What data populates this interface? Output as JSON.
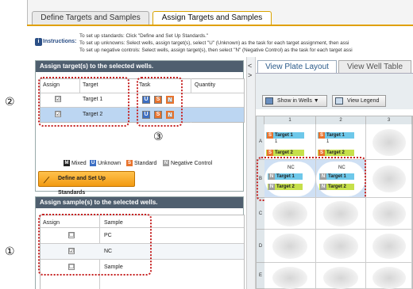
{
  "tabs": {
    "define": "Define Targets and Samples",
    "assign": "Assign Targets and Samples"
  },
  "instructions": {
    "label": "Instructions:",
    "line1": "To set up standards: Click \"Define and Set Up Standards.\"",
    "line2": "To set up unknowns: Select wells, assign target(s), select \"U\" (Unknown) as the task for each target assignment, then assi",
    "line3": "To set up negative controls: Select wells, assign target(s), then select \"N\" (Negative Control) as the task for each target assi"
  },
  "assign_targets": {
    "title": "Assign target(s) to the selected wells.",
    "headers": {
      "assign": "Assign",
      "target": "Target",
      "task": "Task",
      "quantity": "Quantity"
    },
    "rows": [
      {
        "checked": "☑",
        "target": "Target 1"
      },
      {
        "checked": "☑",
        "target": "Target 2"
      }
    ],
    "task_buttons": {
      "u": "U",
      "s": "S",
      "n": "N"
    }
  },
  "legend": {
    "mixed_icon": "M",
    "mixed": "Mixed",
    "unknown_icon": "U",
    "unknown": "Unknown",
    "standard_icon": "S",
    "standard": "Standard",
    "negative_icon": "N",
    "negative": "Negative Control"
  },
  "define_standards_button": "Define and Set Up Standards",
  "assign_samples": {
    "title": "Assign sample(s) to the selected wells.",
    "headers": {
      "assign": "Assign",
      "sample": "Sample"
    },
    "rows": [
      {
        "checked": "☐",
        "sample": "PC"
      },
      {
        "checked": "☑",
        "sample": "NC"
      },
      {
        "checked": "☐",
        "sample": "Sample"
      }
    ]
  },
  "annotations": {
    "one": "①",
    "two": "②",
    "three": "③"
  },
  "right": {
    "tab_plate": "View Plate Layout",
    "tab_well": "View Well Table",
    "show_in_wells": "Show in Wells ▼",
    "view_legend": "View Legend",
    "columns": [
      "1",
      "2",
      "3"
    ],
    "rows": [
      "A",
      "B",
      "C",
      "D",
      "E"
    ],
    "wellA": {
      "s_icon": "S",
      "t1": "Target 1",
      "t1_qty": "1",
      "t2": "Target 2"
    },
    "wellB": {
      "label": "NC",
      "n_icon": "N",
      "t1": "Target 1",
      "t2": "Target 2"
    },
    "collapse_left": "<",
    "collapse_right": ">"
  },
  "colors": {
    "unknown": "#3c6fc4",
    "standard": "#e8732d",
    "negative": "#9e9e9e",
    "target1": "#6ec8ea",
    "target2": "#c6e04a",
    "annotation": "#c62020",
    "tab_accent": "#e0a000"
  }
}
